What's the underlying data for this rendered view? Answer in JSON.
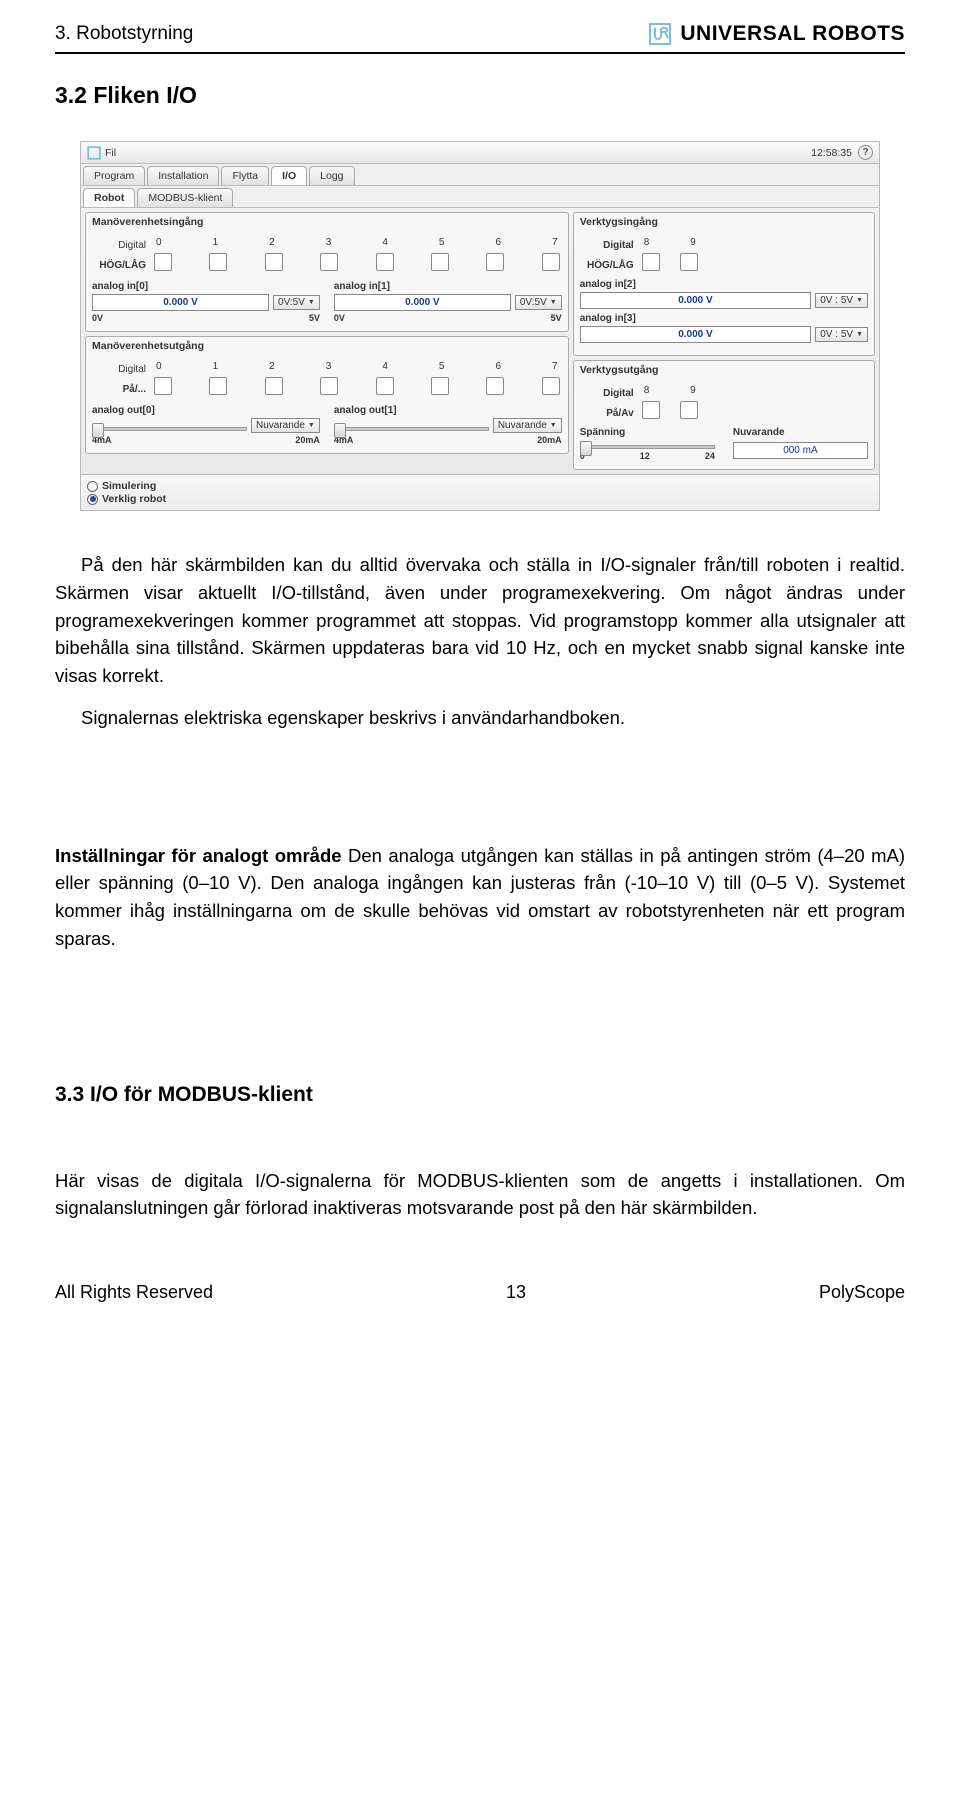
{
  "doc": {
    "header_left": "3. Robotstyrning",
    "brand": "UNIVERSAL ROBOTS",
    "section_32": "3.2   Fliken I/O",
    "section_33": "3.3   I/O för MODBUS-klient",
    "para1": "På den här skärmbilden kan du alltid övervaka och ställa in I/O-signaler från/till roboten i realtid. Skärmen visar aktuellt I/O-tillstånd, även under programexekvering. Om något ändras under programexekveringen kommer programmet att stoppas. Vid programstopp kommer alla utsignaler att bibehålla sina tillstånd. Skärmen uppdateras bara vid 10 Hz, och en mycket snabb signal kanske inte visas korrekt.",
    "para2": "Signalernas elektriska egenskaper beskrivs i användarhandboken.",
    "para3_runin": "Inställningar för analogt område",
    "para3_rest": "   Den analoga utgången kan ställas in på antingen ström (4–20 mA) eller spänning (0–10 V). Den analoga ingången kan justeras från (-10–10 V) till (0–5 V). Systemet kommer ihåg inställningarna om de skulle behövas vid omstart av robotstyrenheten när ett program sparas.",
    "para4": "Här visas de digitala I/O-signalerna för MODBUS-klienten som de angetts i installationen. Om signalanslutningen går förlorad inaktiveras motsvarande post på den här skärmbilden.",
    "footer_left": "All Rights Reserved",
    "footer_page": "13",
    "footer_right": "PolyScope"
  },
  "ss": {
    "file_menu": "Fil",
    "time": "12:58:35",
    "tabs1": [
      "Program",
      "Installation",
      "Flytta",
      "I/O",
      "Logg"
    ],
    "tabs1_active": "I/O",
    "tabs2": [
      "Robot",
      "MODBUS-klient"
    ],
    "tabs2_active": "Robot",
    "panel_in_left_title": "Manöverenhetsingång",
    "panel_in_right_title": "Verktygsingång",
    "panel_out_left_title": "Manöverenhetsutgång",
    "panel_out_right_title": "Verktygsutgång",
    "digital_label": "Digital",
    "hoglag": "HÖG/LÅG",
    "nums8": [
      "0",
      "1",
      "2",
      "3",
      "4",
      "5",
      "6",
      "7"
    ],
    "nums89": [
      "8",
      "9"
    ],
    "analog_in0": "analog in[0]",
    "analog_in1": "analog in[1]",
    "analog_in2": "analog in[2]",
    "analog_in3": "analog in[3]",
    "analog_out0": "analog out[0]",
    "analog_out1": "analog out[1]",
    "val0v": "0.000 V",
    "range_0v5v": "0V:5V",
    "range_0v_5v_sp": "0V : 5V",
    "pa": "På/...",
    "paav": "På/Av",
    "nuvarande": "Nuvarande",
    "spanning": "Spänning",
    "scale_0v": "0V",
    "scale_5v": "5V",
    "scale_4ma": "4mA",
    "scale_20ma": "20mA",
    "scale_0": "0",
    "scale_12": "12",
    "scale_24": "24",
    "current_val": "000 mA",
    "simulering": "Simulering",
    "verklig": "Verklig robot"
  }
}
